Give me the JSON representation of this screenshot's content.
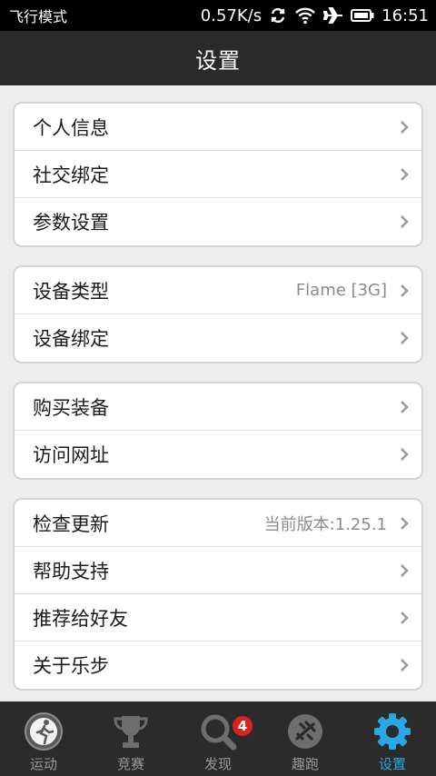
{
  "status_bar": {
    "mode": "飞行模式",
    "speed": "0.57K/s",
    "time": "16:51"
  },
  "title": "设置",
  "groups": [
    {
      "rows": [
        {
          "label": "个人信息"
        },
        {
          "label": "社交绑定"
        },
        {
          "label": "参数设置"
        }
      ]
    },
    {
      "rows": [
        {
          "label": "设备类型",
          "value": "Flame [3G]"
        },
        {
          "label": "设备绑定"
        }
      ]
    },
    {
      "rows": [
        {
          "label": "购买装备"
        },
        {
          "label": "访问网址"
        }
      ]
    },
    {
      "rows": [
        {
          "label": "检查更新",
          "value": "当前版本:1.25.1"
        },
        {
          "label": "帮助支持"
        },
        {
          "label": "推荐给好友"
        },
        {
          "label": "关于乐步"
        }
      ]
    }
  ],
  "tabs": [
    {
      "label": "运动",
      "icon": "run-icon"
    },
    {
      "label": "竞赛",
      "icon": "trophy-icon"
    },
    {
      "label": "发现",
      "icon": "discover-search-icon",
      "badge": "4"
    },
    {
      "label": "趣跑",
      "icon": "fun-run-icon"
    },
    {
      "label": "设置",
      "icon": "gear-icon",
      "active": true
    }
  ],
  "colors": {
    "accent": "#2aa8e6",
    "badge": "#d8241f",
    "header": "#2a2a2a",
    "tabbar": "#2b2b2b"
  }
}
